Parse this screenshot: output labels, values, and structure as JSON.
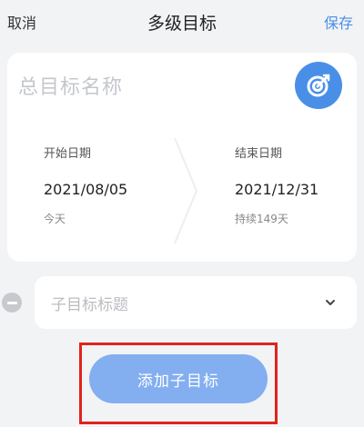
{
  "nav": {
    "cancel_label": "取消",
    "title": "多级目标",
    "save_label": "保存"
  },
  "goal": {
    "name_placeholder": "总目标名称",
    "icon": "target-icon"
  },
  "dates": {
    "start": {
      "label": "开始日期",
      "value": "2021/08/05",
      "sub": "今天"
    },
    "end": {
      "label": "结束日期",
      "value": "2021/12/31",
      "sub": "持续149天"
    }
  },
  "subgoal": {
    "title_placeholder": "子目标标题"
  },
  "actions": {
    "add_label": "添加子目标"
  },
  "colors": {
    "accent": "#4a8fe7",
    "button": "#83aef0",
    "highlight": "#e0231c",
    "background": "#f2f3f5"
  }
}
